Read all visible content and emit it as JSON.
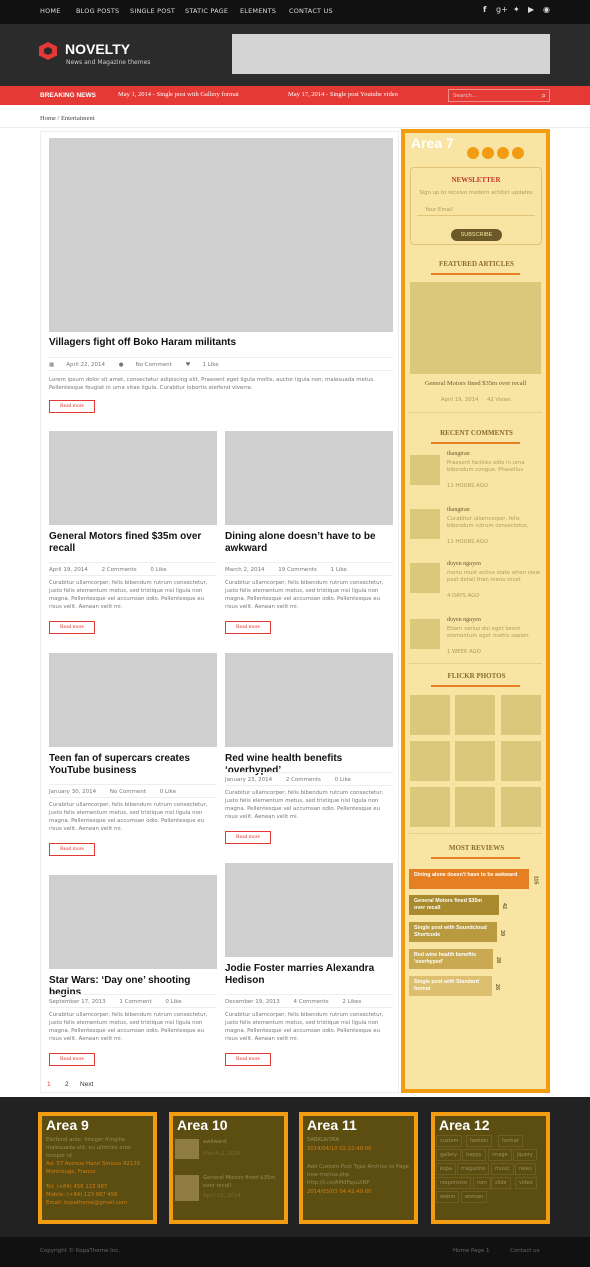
{
  "top_menu": [
    "HOME",
    "BLOG POSTS",
    "SINGLE POST",
    "STATIC PAGE",
    "ELEMENTS",
    "CONTACT US"
  ],
  "social_icons": [
    "facebook-icon",
    "google-plus-icon",
    "twitter-icon",
    "youtube-icon",
    "rss-icon"
  ],
  "logo": {
    "title": "NOVELTY",
    "subtitle": "News and Magazine themes"
  },
  "breaking": {
    "label": "BREAKING NEWS",
    "items": [
      "May 1, 2014 - Single post with Gallery format",
      "May 17, 2014 - Single post Youtube video"
    ],
    "search_placeholder": "Search..."
  },
  "breadcrumb": "Home / Entertaiment",
  "posts": [
    {
      "title": "Villagers fight off Boko Haram militants",
      "date": "April 22, 2014",
      "comments": "No Comment",
      "likes": "1 Like",
      "excerpt": "Lorem ipsum dolor sit amet, consectetur adipiscing elit. Praesent eget ligula mollis, auctor ligula non, malesuada metus. Pellentesque feugiat in urna vitae ligula. Curabitur lobortis eleifend viverra.",
      "read_more": "Read more"
    },
    {
      "title": "General Motors fined $35m over recall",
      "date": "April 19, 2014",
      "comments": "2 Comments",
      "likes": "0 Like",
      "excerpt": "Curabitur ullamcorper, felis bibendum rutrum consectetur, justo felis elementum metus, sed tristique nisl ligula non magna. Pellentesque vel accumsan odio. Pellentesque eu risus velit. Aenean velit mi.",
      "read_more": "Read more"
    },
    {
      "title": "Dining alone doesn’t have to be awkward",
      "date": "March 2, 2014",
      "comments": "19 Comments",
      "likes": "1 Like",
      "excerpt": "Curabitur ullamcorper, felis bibendum rutrum consectetur, justo felis elementum metus, sed tristique nisl ligula non magna. Pellentesque vel accumsan odio. Pellentesque eu risus velit. Aenean velit mi.",
      "read_more": "Read more"
    },
    {
      "title": "Teen fan of supercars creates YouTube business",
      "date": "January 30, 2014",
      "comments": "No Comment",
      "likes": "0 Like",
      "excerpt": "Curabitur ullamcorper, felis bibendum rutrum consectetur, justo felis elementum metus, sed tristique nisl ligula non magna. Pellentesque vel accumsan odio. Pellentesque eu risus velit. Aenean velit mi.",
      "read_more": "Read more"
    },
    {
      "title": "Red wine health benefits ‘overhyped’",
      "date": "January 23, 2014",
      "comments": "2 Comments",
      "likes": "0 Like",
      "excerpt": "Curabitur ullamcorper, felis bibendum rutrum consectetur, justo felis elementum metus, sed tristique nisl ligula non magna. Pellentesque vel accumsan odio. Pellentesque eu risus velit. Aenean velit mi.",
      "read_more": "Read more"
    },
    {
      "title": "Star Wars: ‘Day one’ shooting begins",
      "date": "September 17, 2013",
      "comments": "1 Comment",
      "likes": "0 Like",
      "excerpt": "Curabitur ullamcorper, felis bibendum rutrum consectetur, justo felis elementum metus, sed tristique nisl ligula non magna. Pellentesque vel accumsan odio. Pellentesque eu risus velit. Aenean velit mi.",
      "read_more": "Read more"
    },
    {
      "title": "Jodie Foster marries Alexandra Hedison",
      "date": "December 19, 2013",
      "comments": "4 Comments",
      "likes": "2 Likes",
      "excerpt": "Curabitur ullamcorper, felis bibendum rutrum consectetur, justo felis elementum metus, sed tristique nisl ligula non magna. Pellentesque vel accumsan odio. Pellentesque eu risus velit. Aenean velit mi.",
      "read_more": "Read more"
    }
  ],
  "pagination": [
    "1",
    "2",
    "Next"
  ],
  "sidebar": {
    "area_label": "Area 7",
    "newsletter": {
      "title": "NEWSLETTER",
      "text": "Sign up to receive modern achitet updates",
      "placeholder": "Your Email",
      "button": "SUBSCRIBE"
    },
    "featured": {
      "title": "FEATURED ARTICLES",
      "post_title": "General Motors fined $35m over recall",
      "date": "April 19, 2014",
      "views": "42 Views"
    },
    "recent_comments": {
      "title": "RECENT COMMENTS",
      "items": [
        {
          "name": "thangtran",
          "text": "Praesent facilisis odio in urna bibendum congue. Phasellus",
          "time": "11 HOURS AGO"
        },
        {
          "name": "thangtran",
          "text": "Curabitur ullamcorper, felis bibendum rutrum consectetur,",
          "time": "11 HOURS AGO"
        },
        {
          "name": "duyen nguyen",
          "text": "menu must active state when view post detail than menu must",
          "time": "4 DAYS AGO"
        },
        {
          "name": "duyen nguyen",
          "text": "Etiam varius dui eget lorem elementum eget mattis sapien",
          "time": "1 WEEK AGO"
        }
      ]
    },
    "flickr": {
      "title": "FLICKR PHOTOS"
    },
    "reviews": {
      "title": "MOST REVIEWS",
      "items": [
        {
          "label": "Dining alone doesn't have to be awkward",
          "count": "115",
          "share": 1.0
        },
        {
          "label": "General Motors fined $35m over recall",
          "count": "42",
          "share": 0.37
        },
        {
          "label": "Single post with Soundcloud Shortcode",
          "count": "39",
          "share": 0.34
        },
        {
          "label": "Red wine health benefits 'overhyped'",
          "count": "28",
          "share": 0.24
        },
        {
          "label": "Single post with Standard format",
          "count": "26",
          "share": 0.23
        }
      ]
    }
  },
  "footer": {
    "area9": {
      "label": "Area 9",
      "text": "Eleifend ante. Integer fringilla malesuada elit, eu ultricies eros tempor id.",
      "address": "Ad: 57 Avenue Hanri Simous 92120 Montrouge, France",
      "phone": "Tel: (+84) 456 123 987",
      "mobile": "Mobile: (+84) 123 987 456",
      "email": "Email: kopatheme@gmail.com"
    },
    "area10": {
      "label": "Area 10",
      "item1_title": "awkward",
      "item1_date": "March 2, 2014",
      "item2_title": "General Motors fined $35m over recall",
      "item2_date": "April 19, 2014"
    },
    "area11": {
      "label": "Area 11",
      "line1": "5ABKLW3RA",
      "line1_date": "2014/04/10 02:22:49:00",
      "line2": "Add Custom Post Type Archive to Page new-menus.php http://t.co/AMdFapuXNF",
      "line2_date": "2014/03/03 04:42:49:00"
    },
    "area12": {
      "label": "Area 12",
      "tags": [
        "custom",
        "fashion",
        "format",
        "gallery",
        "happy",
        "image",
        "jquery",
        "kopa",
        "magazine",
        "music",
        "news",
        "responsive",
        "rom",
        "slide",
        "video",
        "webm",
        "woman"
      ]
    }
  },
  "bottom": {
    "copyright": "Copyright © KopaTheme Inc.",
    "links": [
      "Home Page 1",
      "Contact us"
    ]
  },
  "colors": {
    "accent": "#e53935",
    "area_orange": "#f39c12",
    "area_fill": "#f8e5a3",
    "footer_area": "#5c4d10"
  }
}
